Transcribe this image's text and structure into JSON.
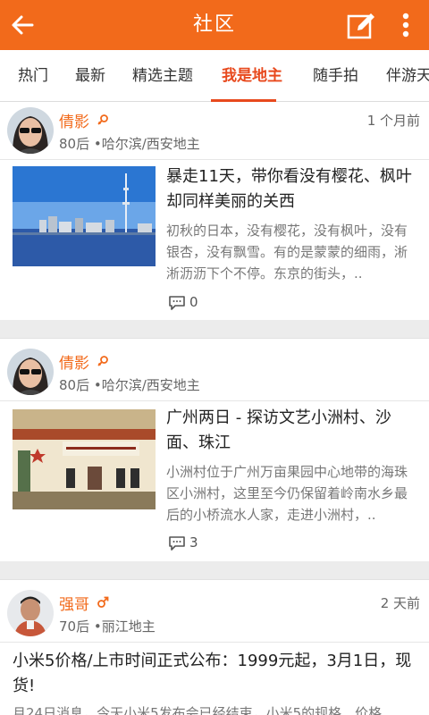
{
  "header": {
    "title": "社区"
  },
  "tabs": [
    {
      "label": "热门"
    },
    {
      "label": "最新"
    },
    {
      "label": "精选主题"
    },
    {
      "label": "我是地主"
    },
    {
      "label": "随手拍"
    },
    {
      "label": "伴游天"
    }
  ],
  "active_tab": "我是地主",
  "posts": [
    {
      "user": "倩影",
      "gender": "female",
      "meta": "80后 •哈尔滨/西安地主",
      "time": "1 个月前",
      "title": "暴走11天，带你看没有樱花、枫叶却同样美丽的关西",
      "summary": "初秋的日本，没有樱花，没有枫叶，没有银杏，没有飘雪。有的是蒙蒙的细雨，淅淅沥沥下个不停。东京的街头，..",
      "comments": "0"
    },
    {
      "user": "倩影",
      "gender": "female",
      "meta": "80后 •哈尔滨/西安地主",
      "time": "",
      "title": "广州两日 - 探访文艺小洲村、沙面、珠江",
      "summary": "小洲村位于广州万亩果园中心地带的海珠区小洲村，这里至今仍保留着岭南水乡最后的小桥流水人家，走进小洲村，..",
      "comments": "3"
    },
    {
      "user": "强哥",
      "gender": "male",
      "meta": "70后 •丽江地主",
      "time": "2 天前",
      "title": "小米5价格/上市时间正式公布：1999元起，3月1日，现货!",
      "summary": "月24日消息，今天小米5发布会已经结束，小米5的规格、价格"
    }
  ],
  "colors": {
    "brand": "#f26a1b",
    "active": "#e8491d",
    "male": "#f26a1b"
  }
}
